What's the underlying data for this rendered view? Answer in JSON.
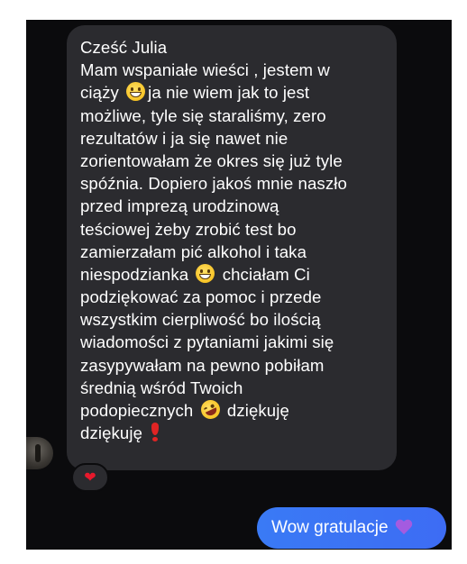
{
  "incoming_message": {
    "lines": [
      "Cześć Julia",
      "Mam wspaniałe wieści , jestem w",
      "ciąży ",
      "ja nie wiem jak to jest",
      "możliwe, tyle się staraliśmy, zero",
      "rezultatów i ja się nawet nie",
      "zorientowałam że okres się już tyle",
      "spóźnia. Dopiero jakoś mnie naszło",
      "przed imprezą urodzinową",
      "teściowej żeby zrobić test bo",
      "zamierzałam pić alkohol i taka",
      "niespodzianka ",
      " chciałam Ci",
      "podziękować za pomoc i przede",
      "wszystkim cierpliwość bo ilością",
      "wiadomości z pytaniami jakimi się",
      "zasypywałam na pewno pobiłam",
      "średnią wśród Twoich",
      "podopiecznych ",
      " dziękuję",
      "dziękuję "
    ],
    "emojis": [
      "grinning-face",
      "grinning-face",
      "rolling-on-floor-laughing",
      "red-exclamation-mark"
    ]
  },
  "reaction": {
    "symbol": "❤",
    "color": "#e8192c"
  },
  "outgoing_message": {
    "text": "Wow gratulacje",
    "emoji": "purple-heart"
  },
  "colors": {
    "chat_background": "#0b0b0d",
    "incoming_bubble": "#2b2b2f",
    "outgoing_bubble": "#3b6ff6"
  }
}
